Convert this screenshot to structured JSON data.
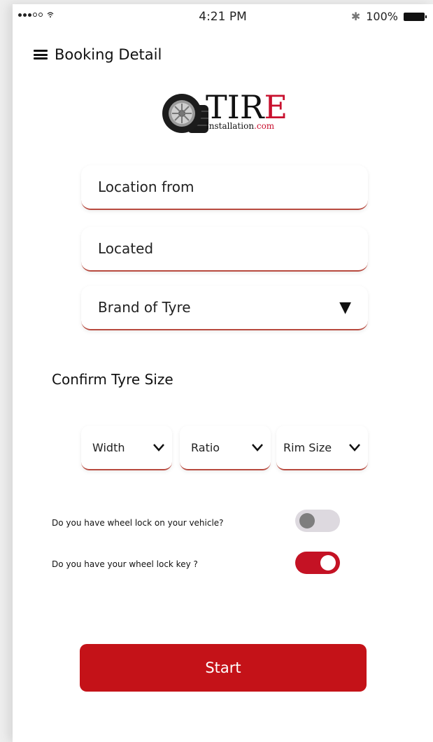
{
  "status_bar": {
    "time": "4:21 PM",
    "battery_percent": "100%",
    "signal_icon": "signal-dots-icon",
    "wifi_icon": "wifi-icon",
    "bluetooth_icon": "bluetooth-icon"
  },
  "header": {
    "title": "Booking Detail",
    "menu_icon": "menu-icon"
  },
  "logo": {
    "word_main": "TIR",
    "word_accent": "E",
    "sub_main": "Installation",
    "sub_accent": ".com"
  },
  "form": {
    "location_from": "Location from",
    "located": "Located",
    "brand": "Brand of Tyre",
    "brand_caret": "▼"
  },
  "tyre_size": {
    "title": "Confirm Tyre Size",
    "width": "Width",
    "ratio": "Ratio",
    "rim": "Rim Size"
  },
  "questions": {
    "wheel_lock": "Do you have wheel lock on your  vehicle?",
    "wheel_lock_on": false,
    "wheel_key": "Do you have your wheel lock key ?",
    "wheel_key_on": true
  },
  "actions": {
    "start": "Start"
  },
  "colors": {
    "accent": "#c41218",
    "field_border": "#b84a3f",
    "toggle_off": "#ddd9df"
  }
}
